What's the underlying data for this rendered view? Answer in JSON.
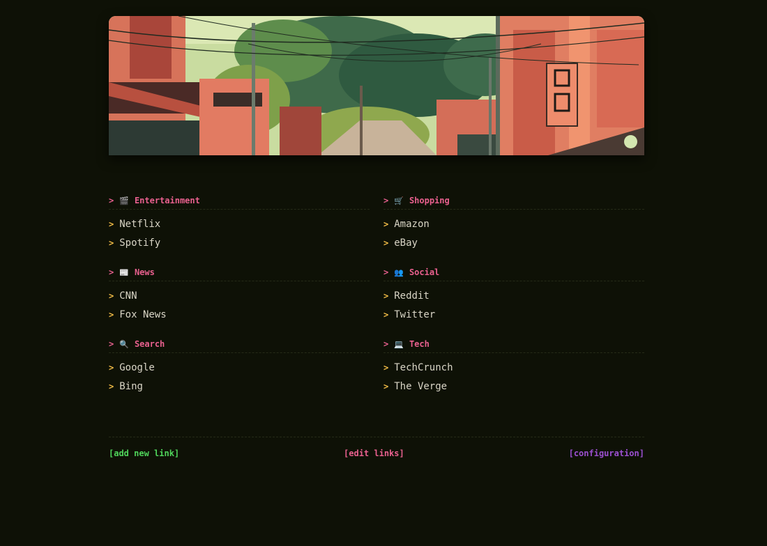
{
  "colors": {
    "background": "#0e1106",
    "heading": "#e8608e",
    "bullet": "#f3bd47",
    "link_text": "#d9d5c6",
    "add": "#4fd35a",
    "edit": "#e8608e",
    "config": "#9b4fd0",
    "theme_dot": "#d4e6b0"
  },
  "arrow": ">",
  "sections": [
    {
      "title": "Entertainment",
      "icon": "clapperboard-icon",
      "emoji": "🎬",
      "links": [
        "Netflix",
        "Spotify"
      ]
    },
    {
      "title": "Shopping",
      "icon": "cart-icon",
      "emoji": "🛒",
      "links": [
        "Amazon",
        "eBay"
      ]
    },
    {
      "title": "News",
      "icon": "newspaper-icon",
      "emoji": "📰",
      "links": [
        "CNN",
        "Fox News"
      ]
    },
    {
      "title": "Social",
      "icon": "people-icon",
      "emoji": "👥",
      "links": [
        "Reddit",
        "Twitter"
      ]
    },
    {
      "title": "Search",
      "icon": "magnifier-icon",
      "emoji": "🔍",
      "links": [
        "Google",
        "Bing"
      ]
    },
    {
      "title": "Tech",
      "icon": "laptop-icon",
      "emoji": "💻",
      "links": [
        "TechCrunch",
        "The Verge"
      ]
    }
  ],
  "footer": {
    "add": "[add new link]",
    "edit": "[edit links]",
    "config": "[configuration]"
  }
}
